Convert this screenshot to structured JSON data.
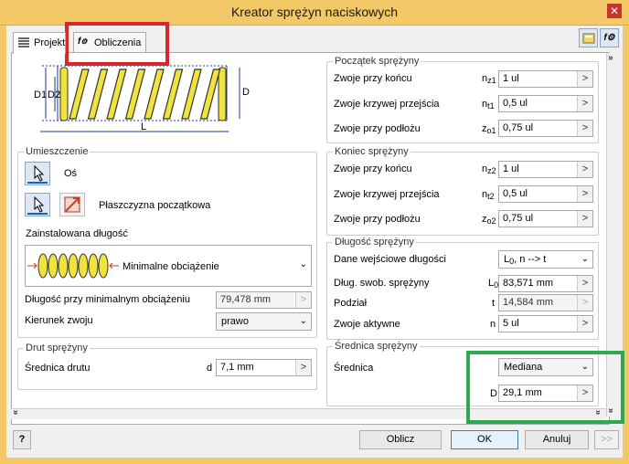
{
  "window": {
    "title": "Kreator sprężyn naciskowych",
    "close": "✕"
  },
  "tabs": [
    {
      "label": "Projekt"
    },
    {
      "label": "Obliczenia"
    }
  ],
  "diagram": {
    "d1": "D1",
    "d2": "D2",
    "d": "D",
    "l": "L"
  },
  "placement": {
    "title": "Umieszczenie",
    "axis": "Oś",
    "start_plane": "Płaszczyzna początkowa",
    "installed_length": "Zainstalowana długość",
    "installed_option": "Minimalne obciążenie",
    "min_load_length_label": "Długość przy minimalnym obciążeniu",
    "min_load_length_value": "79,478 mm",
    "coil_direction_label": "Kierunek zwoju",
    "coil_direction_value": "prawo"
  },
  "wire": {
    "title": "Drut sprężyny",
    "diameter_label": "Średnica drutu",
    "symbol": "d",
    "value": "7,1 mm"
  },
  "start": {
    "title": "Początek sprężyny",
    "rows": [
      {
        "label": "Zwoje przy końcu",
        "sym": "n",
        "sub": "z1",
        "value": "1 ul"
      },
      {
        "label": "Zwoje krzywej przejścia",
        "sym": "n",
        "sub": "t1",
        "value": "0,5 ul"
      },
      {
        "label": "Zwoje przy podłożu",
        "sym": "z",
        "sub": "o1",
        "value": "0,75 ul"
      }
    ]
  },
  "end": {
    "title": "Koniec sprężyny",
    "rows": [
      {
        "label": "Zwoje przy końcu",
        "sym": "n",
        "sub": "z2",
        "value": "1 ul"
      },
      {
        "label": "Zwoje krzywej przejścia",
        "sym": "n",
        "sub": "t2",
        "value": "0,5 ul"
      },
      {
        "label": "Zwoje przy podłożu",
        "sym": "z",
        "sub": "o2",
        "value": "0,75 ul"
      }
    ]
  },
  "length": {
    "title": "Długość sprężyny",
    "input_label": "Dane wejściowe długości",
    "input_value_main": "L",
    "input_value_sub": "0",
    "input_value_rest": ", n --> t",
    "free_label": "Dług. swob. sprężyny",
    "free_sym": "L",
    "free_sub": "0",
    "free_value": "83,571 mm",
    "pitch_label": "Podział",
    "pitch_sym": "t",
    "pitch_value": "14,584 mm",
    "active_label": "Zwoje aktywne",
    "active_sym": "n",
    "active_value": "5 ul"
  },
  "diameter": {
    "title": "Średnica sprężyny",
    "label": "Średnica",
    "mode": "Mediana",
    "sym": "D",
    "value": "29,1 mm"
  },
  "buttons": {
    "help": "?",
    "calculate": "Oblicz",
    "ok": "OK",
    "cancel": "Anuluj",
    "more": ">>"
  },
  "icons": {
    "arrow": ">",
    "dropdown": "⌄",
    "chevrons_right": "»",
    "chevrons_down": "»"
  },
  "colors": {
    "titlebar": "#f3c867",
    "spring": "#f0e33c",
    "highlight_red": "#d9262c",
    "highlight_green": "#2fa84f"
  }
}
